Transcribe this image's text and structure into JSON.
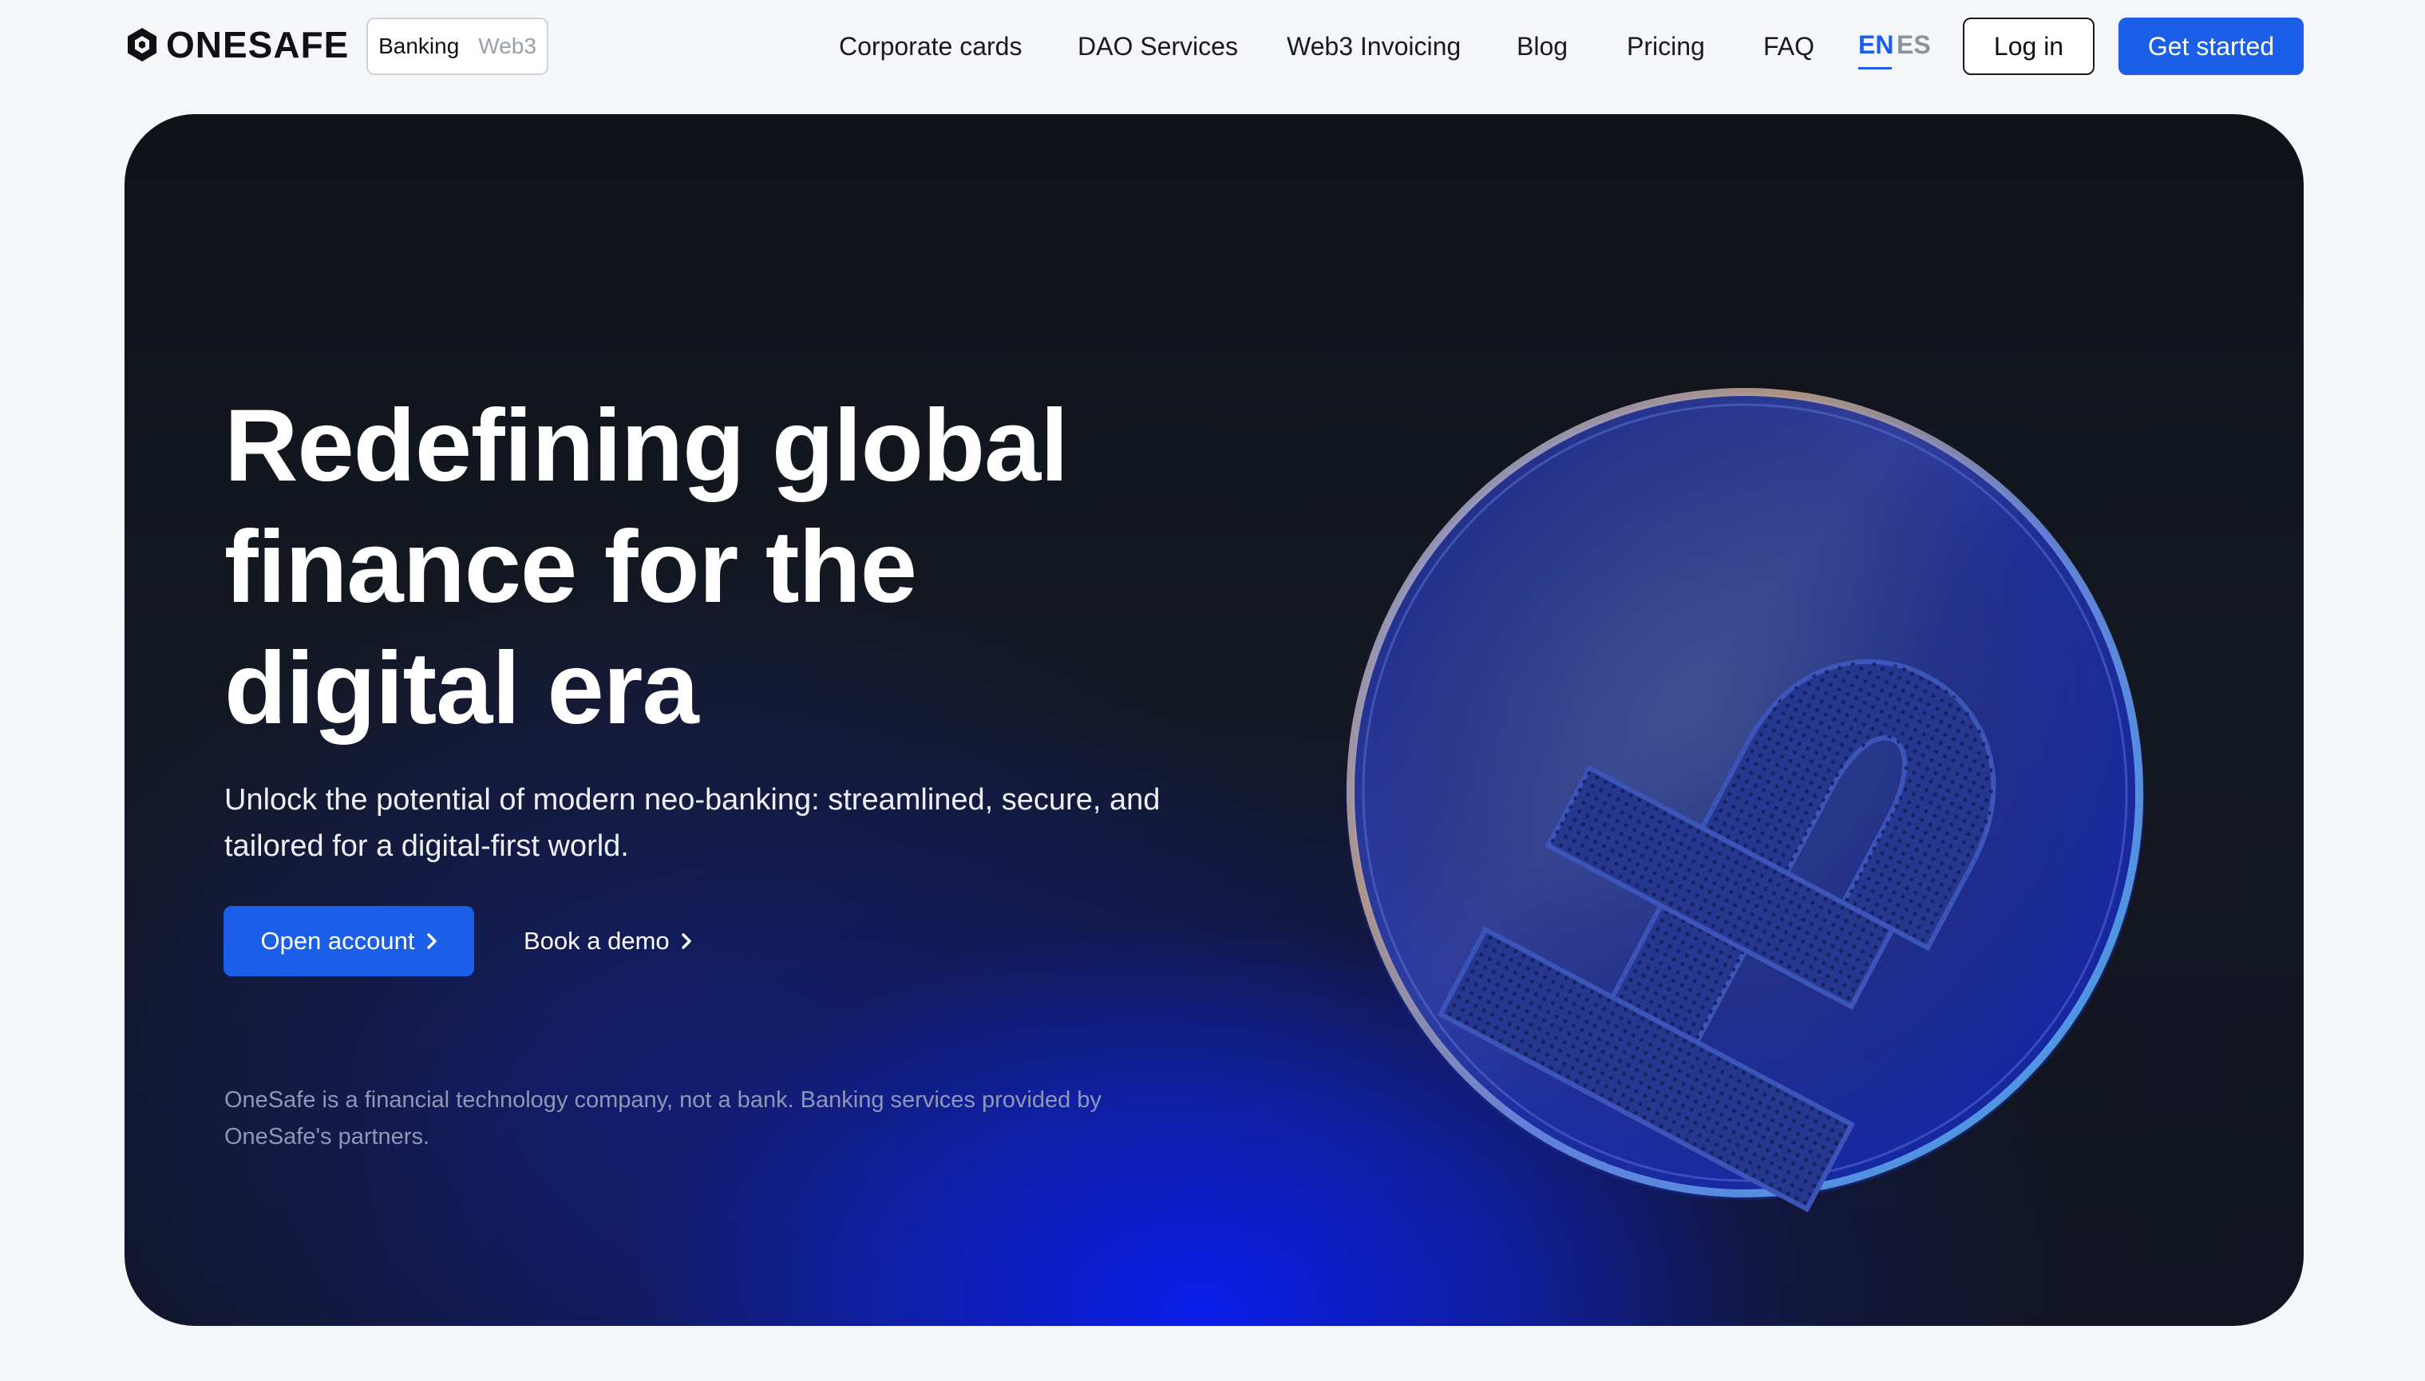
{
  "brand": {
    "logo_text": "ONESAFE"
  },
  "mode_toggle": {
    "active": "Banking",
    "inactive": "Web3"
  },
  "nav": {
    "items": [
      "Corporate cards",
      "DAO Services",
      "Web3 Invoicing",
      "Blog",
      "Pricing",
      "FAQ"
    ],
    "languages": {
      "active": "EN",
      "inactive": "ES"
    },
    "login_label": "Log in",
    "cta_label": "Get started"
  },
  "hero": {
    "title_lines": [
      "Redefining global",
      "finance for the",
      "digital era"
    ],
    "subtitle_lines": [
      "Unlock the potential of modern neo-banking: streamlined, secure, and",
      "tailored for a digital-first world."
    ],
    "primary_cta": "Open account",
    "secondary_cta": "Book a demo",
    "disclaimer_lines": [
      "OneSafe is a financial technology company, not a bank. Banking services provided by",
      "OneSafe's partners."
    ]
  },
  "colors": {
    "accent": "#1b5fe8",
    "hero_bg": "#121521",
    "page_bg": "#f5f6f9"
  },
  "icons": {
    "logo": "hexagon-logo-icon",
    "chevron": "chevron-right-icon",
    "coin": "pound-coin-illustration"
  }
}
